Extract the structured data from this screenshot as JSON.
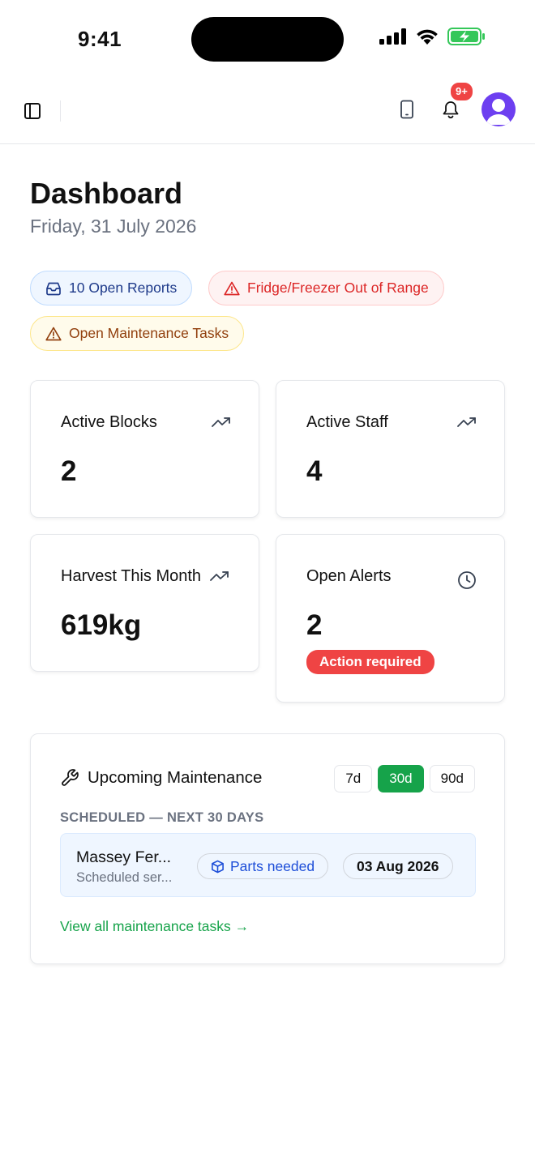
{
  "status_bar": {
    "time": "9:41"
  },
  "nav": {
    "notification_count": "9+"
  },
  "header": {
    "title": "Dashboard",
    "date": "Friday, 31 July 2026"
  },
  "chips": [
    {
      "label": "10 Open Reports",
      "icon": "inbox-icon",
      "color": "#1e3a8a"
    },
    {
      "label": "Fridge/Freezer Out of Range",
      "icon": "warning-icon",
      "color": "#dc2626"
    },
    {
      "label": "Open Maintenance Tasks",
      "icon": "warning-icon",
      "color": "#92400e"
    }
  ],
  "stats": [
    {
      "label": "Active Blocks",
      "value": "2",
      "icon": "trending-up-icon"
    },
    {
      "label": "Active Staff",
      "value": "4",
      "icon": "trending-up-icon"
    },
    {
      "label": "Harvest This Month",
      "value": "619kg",
      "icon": "trending-up-icon"
    },
    {
      "label": "Open Alerts",
      "value": "2",
      "icon": "clock-icon",
      "status": "Action required"
    }
  ],
  "maintenance": {
    "title": "Upcoming Maintenance",
    "ranges": [
      "7d",
      "30d",
      "90d"
    ],
    "active_range": "30d",
    "subtitle": "SCHEDULED — NEXT 30 DAYS",
    "items": [
      {
        "name": "Massey Fer...",
        "description": "Scheduled ser...",
        "tag": "Parts needed",
        "date": "03 Aug 2026"
      }
    ],
    "link": "View all maintenance tasks →"
  },
  "colors": {
    "accent": "#16a34a",
    "danger": "#ef4444",
    "brand_avatar": "#6d3ff0"
  }
}
